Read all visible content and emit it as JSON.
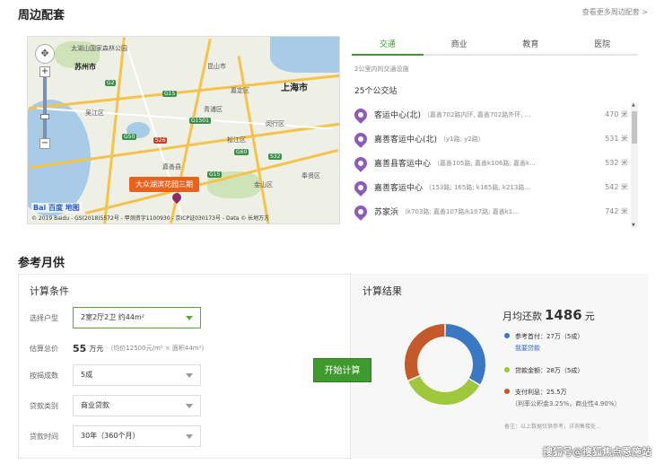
{
  "surroundings": {
    "title": "周边配套",
    "more_link": "查看更多周边配套 >",
    "map": {
      "city_labels": [
        {
          "text": "太湖山国家森林公园"
        },
        {
          "text": "苏州市"
        },
        {
          "text": "昆山市"
        },
        {
          "text": "上海市"
        },
        {
          "text": "嘉定区"
        },
        {
          "text": "青浦区"
        },
        {
          "text": "松江区"
        },
        {
          "text": "吴江区"
        },
        {
          "text": "嘉善县"
        },
        {
          "text": "闵行区"
        },
        {
          "text": "金山区"
        },
        {
          "text": "奉贤区"
        }
      ],
      "shields": [
        {
          "text": "G2"
        },
        {
          "text": "G15"
        },
        {
          "text": "G50"
        },
        {
          "text": "G60"
        },
        {
          "text": "S26"
        },
        {
          "text": "G1501"
        },
        {
          "text": "G15"
        },
        {
          "text": "S32"
        }
      ],
      "marker_label": "大众湖滨花园三期",
      "logo": "Bai 百度 地图",
      "copyright": "© 2019 Baidu - GS(2018)5572号 - 甲测资字1100930 - 京ICP证030173号 - Data © 长地万方",
      "pan_icon": "compass-pan-icon",
      "zoom_in": "+",
      "zoom_out": "−"
    },
    "tabs": [
      {
        "label": "交通",
        "active": true
      },
      {
        "label": "商业",
        "active": false
      },
      {
        "label": "教育",
        "active": false
      },
      {
        "label": "医院",
        "active": false
      }
    ],
    "note": "2公里内的交通设施",
    "count": "25个公交站",
    "stops": [
      {
        "name": "客运中心(北)",
        "lines": "（嘉善702路内环, 嘉善702路外环, ...",
        "dist": "470 米"
      },
      {
        "name": "嘉善客运中心(北)",
        "lines": "（y1路; y2路）",
        "dist": "531 米"
      },
      {
        "name": "嘉善县客运中心",
        "lines": "（嘉善105路; 嘉善k106路; 嘉善k...",
        "dist": "532 米"
      },
      {
        "name": "嘉善客运中心",
        "lines": "（153路; 165路; k165路; k213路...",
        "dist": "542 米"
      },
      {
        "name": "苏家浜",
        "lines": "（k703路; 嘉善107路/k107路; 嘉善k105路; ...",
        "dist": "742 米"
      }
    ]
  },
  "mortgage": {
    "title": "参考月供",
    "conditions_title": "计算条件",
    "result_title": "计算结果",
    "fields": {
      "layout": {
        "label": "选择户型",
        "value": "2室2厅2卫 约44m²"
      },
      "price": {
        "label": "估算总价",
        "number": "55",
        "unit": "万元",
        "note": "（均价12500元/m² × 面积44m²）"
      },
      "down_payment": {
        "label": "按揭成数",
        "value": "5成"
      },
      "loan_type": {
        "label": "贷款类别",
        "value": "商业贷款"
      },
      "loan_term": {
        "label": "贷款时间",
        "value": "30年（360个月）"
      }
    },
    "calc_button": "开始计算",
    "result": {
      "monthly_label": "月均还款",
      "monthly_value": "1486",
      "monthly_unit": "元",
      "items": [
        {
          "label": "参考首付：27万（5成）",
          "sub": "我要贷款",
          "color": "#3b78c4",
          "share": 27
        },
        {
          "label": "贷款金额：28万（5成）",
          "sub": "",
          "color": "#9ec73c",
          "share": 28
        },
        {
          "label": "支付利息：25.5万",
          "sub": "（利率公积金3.25%，商业性4.90%）",
          "color": "#c45a2a",
          "share": 25.5
        }
      ],
      "disclaimer": "备注：以上数据仅供参考，详询售楼处..."
    }
  },
  "watermark": "搜狐号@搜狐焦点恩施站"
}
